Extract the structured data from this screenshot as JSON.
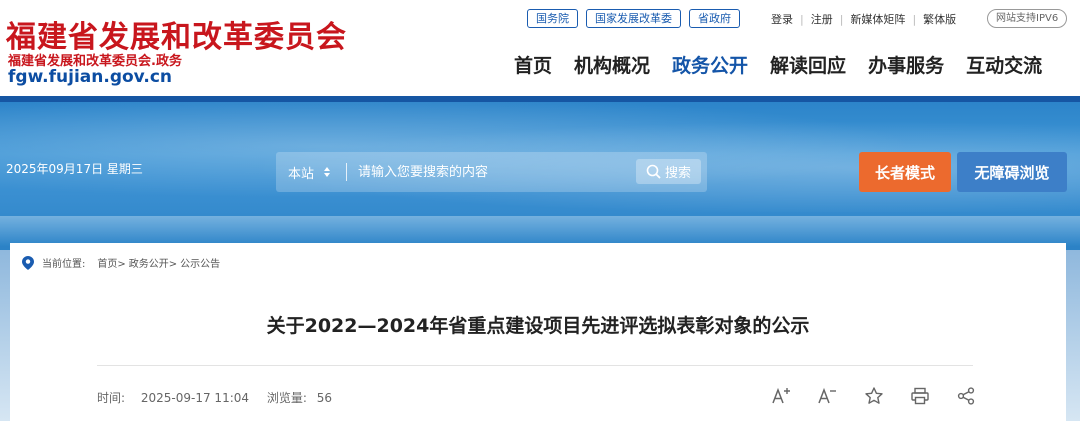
{
  "header": {
    "logo_title": "福建省发展和改革委员会",
    "logo_subtitle": "福建省发展和改革委员会.政务",
    "logo_url": "fgw.fujian.gov.cn",
    "top_links": [
      "国务院",
      "国家发展改革委",
      "省政府"
    ],
    "utility_links": [
      "登录",
      "注册",
      "新媒体矩阵",
      "繁体版"
    ],
    "ipv6_badge": "网站支持IPV6",
    "nav": [
      "首页",
      "机构概况",
      "政务公开",
      "解读回应",
      "办事服务",
      "互动交流"
    ],
    "nav_active_index": 2
  },
  "banner": {
    "date_text": "2025年09月17日 星期三",
    "search_scope": "本站",
    "search_placeholder": "请输入您要搜索的内容",
    "search_button": "搜索",
    "elder_mode": "长者模式",
    "accessible_browse": "无障碍浏览"
  },
  "breadcrumb": {
    "prefix": "当前位置:",
    "items": [
      "首页>",
      "政务公开>",
      "公示公告"
    ]
  },
  "article": {
    "title": "关于2022—2024年省重点建设项目先进评选拟表彰对象的公示",
    "time_label": "时间:",
    "time_value": "2025-09-17 11:04",
    "views_label": "浏览量:",
    "views_value": "56"
  },
  "colors": {
    "brand_red": "#c8161d",
    "nav_active": "#1455a8",
    "elder_button": "#ec6a2e",
    "access_button": "#3d7fc8"
  },
  "tool_icons": [
    "font-increase-icon",
    "font-decrease-icon",
    "star-icon",
    "print-icon",
    "share-icon"
  ]
}
